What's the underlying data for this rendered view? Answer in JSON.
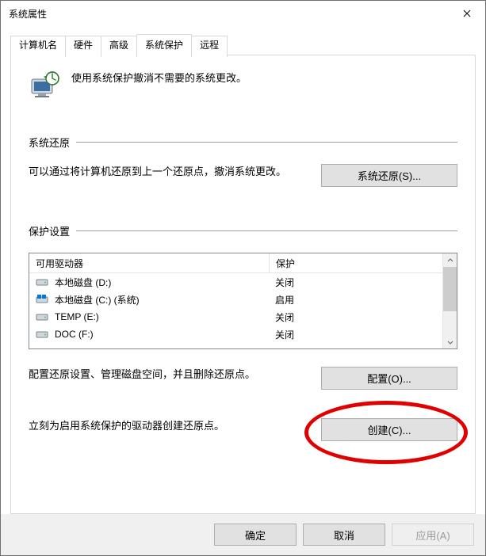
{
  "window": {
    "title": "系统属性"
  },
  "tabs": {
    "items": [
      {
        "label": "计算机名"
      },
      {
        "label": "硬件"
      },
      {
        "label": "高级"
      },
      {
        "label": "系统保护"
      },
      {
        "label": "远程"
      }
    ],
    "active_index": 3
  },
  "intro_text": "使用系统保护撤消不需要的系统更改。",
  "section_restore": {
    "title": "系统还原",
    "desc": "可以通过将计算机还原到上一个还原点，撤消系统更改。",
    "button": "系统还原(S)..."
  },
  "section_settings": {
    "title": "保护设置",
    "columns": {
      "drive": "可用驱动器",
      "protect": "保护"
    },
    "drives": [
      {
        "name": "本地磁盘 (D:)",
        "protect": "关闭",
        "icon": "hdd"
      },
      {
        "name": "本地磁盘 (C:) (系统)",
        "protect": "启用",
        "icon": "winhdd"
      },
      {
        "name": "TEMP (E:)",
        "protect": "关闭",
        "icon": "hdd"
      },
      {
        "name": "DOC (F:)",
        "protect": "关闭",
        "icon": "hdd"
      }
    ],
    "configure": {
      "desc": "配置还原设置、管理磁盘空间，并且删除还原点。",
      "button": "配置(O)..."
    },
    "create": {
      "desc": "立刻为启用系统保护的驱动器创建还原点。",
      "button": "创建(C)..."
    }
  },
  "footer": {
    "ok": "确定",
    "cancel": "取消",
    "apply": "应用(A)"
  }
}
